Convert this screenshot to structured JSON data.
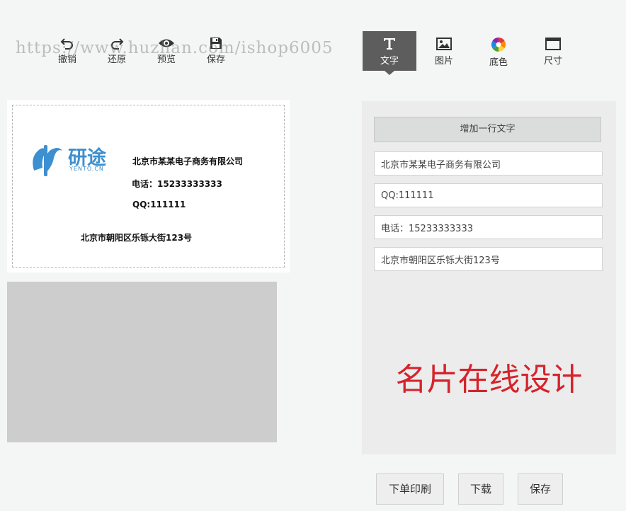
{
  "toolbar": {
    "undo_label": "撤销",
    "redo_label": "还原",
    "preview_label": "预览",
    "save_label": "保存"
  },
  "watermark": "https://www.huzhan.com/ishop6005",
  "tabs": [
    {
      "label": "文字",
      "icon": "text-icon",
      "active": true
    },
    {
      "label": "图片",
      "icon": "image-icon",
      "active": false
    },
    {
      "label": "底色",
      "icon": "color-wheel-icon",
      "active": false
    },
    {
      "label": "尺寸",
      "icon": "size-icon",
      "active": false
    }
  ],
  "card": {
    "logo_text": "研途",
    "logo_subtext": "YENTO.CN",
    "company": "北京市某某电子商务有限公司",
    "phone": "电话：15233333333",
    "qq": "QQ:111111",
    "address": "北京市朝阳区乐铄大街123号",
    "logo_color": "#3d8fd0"
  },
  "panel": {
    "add_line_label": "增加一行文字",
    "fields": [
      {
        "value": "北京市某某电子商务有限公司"
      },
      {
        "value": "QQ:111111"
      },
      {
        "value": "电话：15233333333"
      },
      {
        "value": "北京市朝阳区乐铄大街123号"
      }
    ],
    "promo_text": "名片在线设计",
    "promo_color": "#d5232c"
  },
  "actions": {
    "order_print_label": "下单印刷",
    "download_label": "下载",
    "save_label": "保存"
  }
}
